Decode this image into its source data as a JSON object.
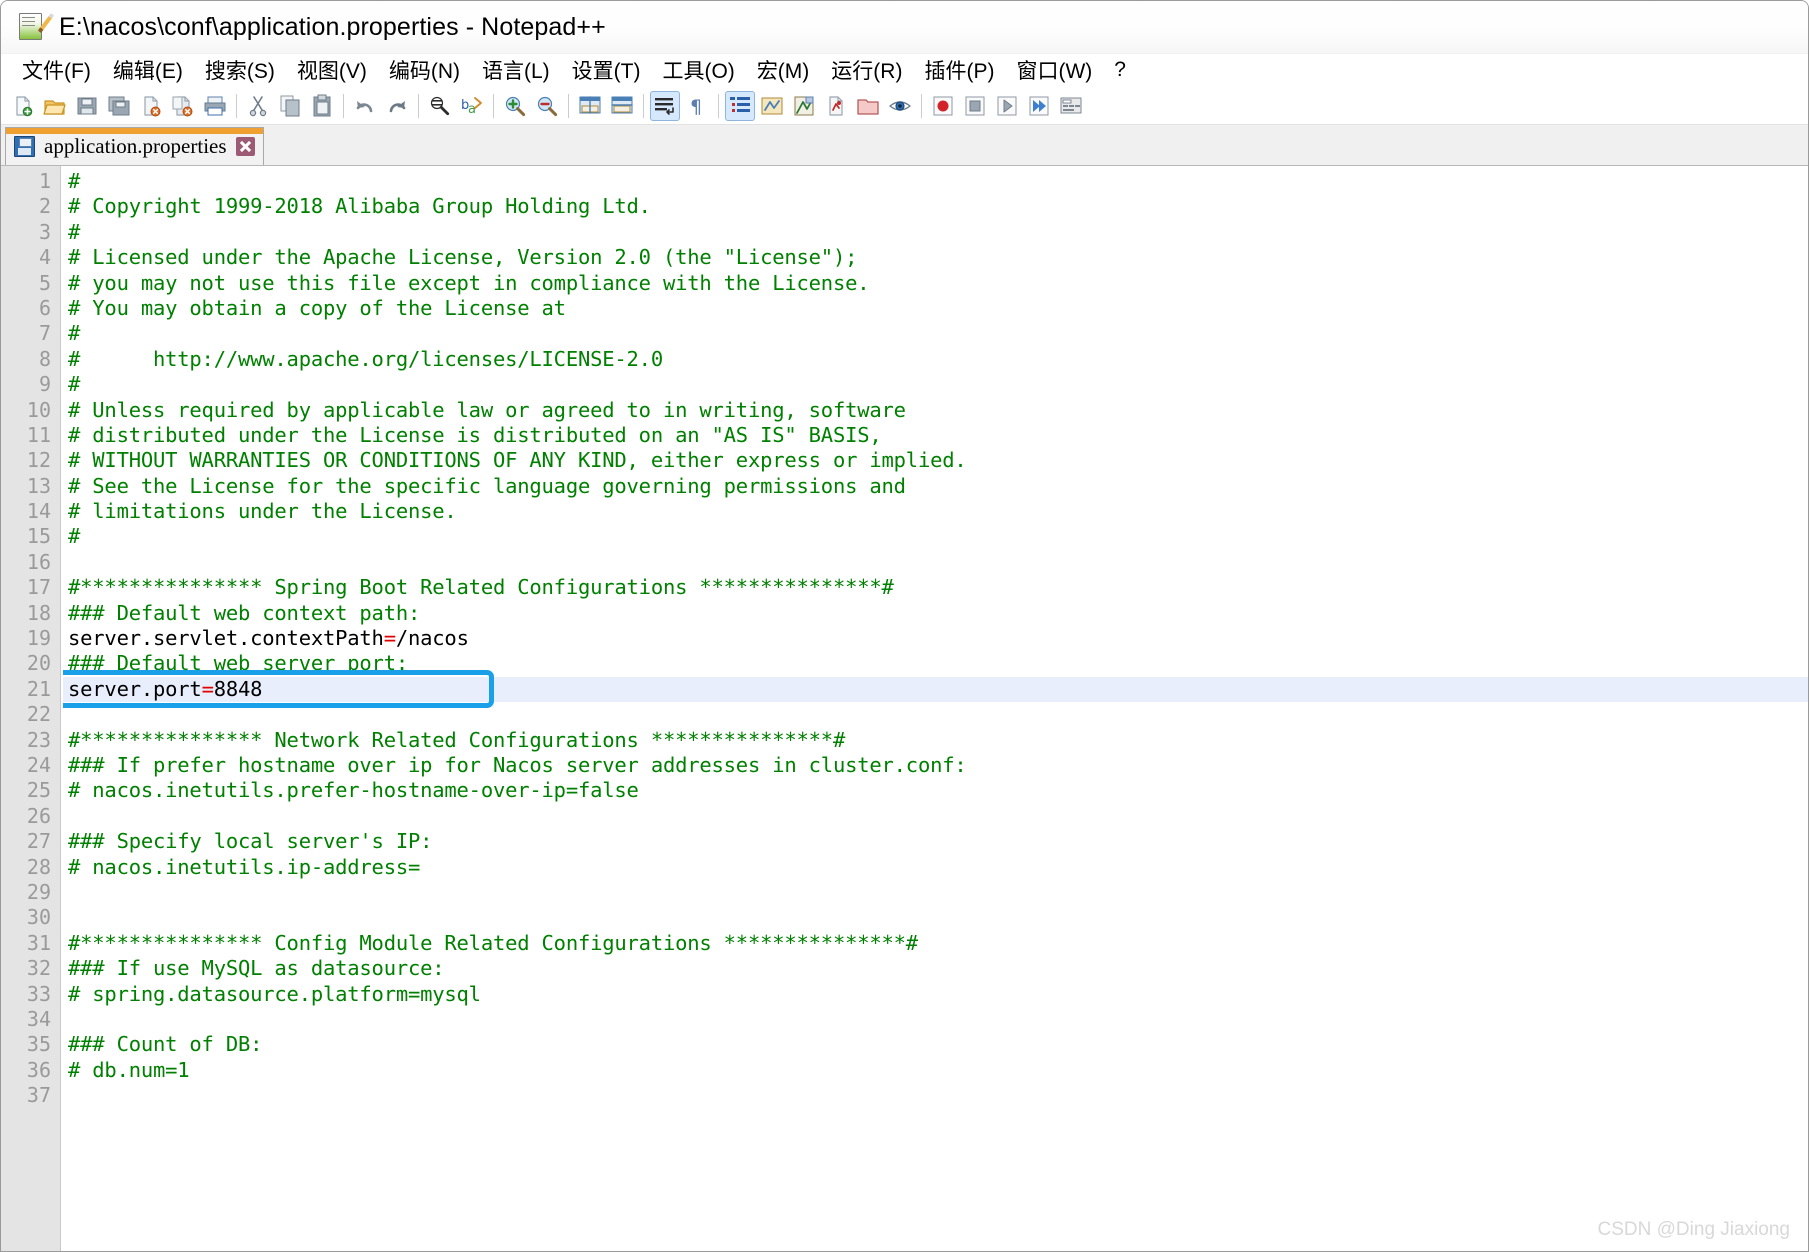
{
  "window": {
    "title": "E:\\nacos\\conf\\application.properties - Notepad++",
    "icon": "notepad-plus-plus-icon"
  },
  "menubar": {
    "items": [
      {
        "label": "文件(F)",
        "name": "menu-file"
      },
      {
        "label": "编辑(E)",
        "name": "menu-edit"
      },
      {
        "label": "搜索(S)",
        "name": "menu-search"
      },
      {
        "label": "视图(V)",
        "name": "menu-view"
      },
      {
        "label": "编码(N)",
        "name": "menu-encoding"
      },
      {
        "label": "语言(L)",
        "name": "menu-language"
      },
      {
        "label": "设置(T)",
        "name": "menu-settings"
      },
      {
        "label": "工具(O)",
        "name": "menu-tools"
      },
      {
        "label": "宏(M)",
        "name": "menu-macro"
      },
      {
        "label": "运行(R)",
        "name": "menu-run"
      },
      {
        "label": "插件(P)",
        "name": "menu-plugins"
      },
      {
        "label": "窗口(W)",
        "name": "menu-window"
      },
      {
        "label": "?",
        "name": "menu-help"
      }
    ]
  },
  "toolbar": {
    "buttons": [
      "new-file-icon",
      "open-file-icon",
      "save-icon",
      "save-all-icon",
      "close-file-icon",
      "close-all-icon",
      "print-icon",
      "sep",
      "cut-icon",
      "copy-icon",
      "paste-icon",
      "sep",
      "undo-icon",
      "redo-icon",
      "sep",
      "find-icon",
      "replace-icon",
      "sep",
      "zoom-in-icon",
      "zoom-out-icon",
      "sep",
      "sync-vertical-scroll-icon",
      "sync-horizontal-scroll-icon",
      "sep",
      "word-wrap-icon",
      "show-all-characters-icon",
      "sep",
      "indent-guide-icon",
      "ui-goto-icon",
      "show-function-list-icon",
      "document-map-icon",
      "folder-as-workspace-icon",
      "monitoring-icon",
      "sep",
      "record-macro-icon",
      "stop-recording-icon",
      "play-macro-icon",
      "run-macro-multiple-icon",
      "save-macro-icon"
    ]
  },
  "tab": {
    "label": "application.properties",
    "icon": "saved-document-icon",
    "close_label": "close-tab"
  },
  "editor": {
    "current_line": 21,
    "highlight": {
      "line": 21,
      "color": "#1aa0e8"
    },
    "colors": {
      "comment": "#008000",
      "key": "#000000",
      "operator": "#e00000",
      "line_number": "#9a9a9a",
      "gutter_bg": "#e4e4e4",
      "current_line_bg": "#e8eefb"
    },
    "lines": [
      {
        "n": 1,
        "tokens": [
          {
            "t": "cmt",
            "s": "#"
          }
        ]
      },
      {
        "n": 2,
        "tokens": [
          {
            "t": "cmt",
            "s": "# Copyright 1999-2018 Alibaba Group Holding Ltd."
          }
        ]
      },
      {
        "n": 3,
        "tokens": [
          {
            "t": "cmt",
            "s": "#"
          }
        ]
      },
      {
        "n": 4,
        "tokens": [
          {
            "t": "cmt",
            "s": "# Licensed under the Apache License, Version 2.0 (the \"License\");"
          }
        ]
      },
      {
        "n": 5,
        "tokens": [
          {
            "t": "cmt",
            "s": "# you may not use this file except in compliance with the License."
          }
        ]
      },
      {
        "n": 6,
        "tokens": [
          {
            "t": "cmt",
            "s": "# You may obtain a copy of the License at"
          }
        ]
      },
      {
        "n": 7,
        "tokens": [
          {
            "t": "cmt",
            "s": "#"
          }
        ]
      },
      {
        "n": 8,
        "tokens": [
          {
            "t": "cmt",
            "s": "#      http://www.apache.org/licenses/LICENSE-2.0"
          }
        ]
      },
      {
        "n": 9,
        "tokens": [
          {
            "t": "cmt",
            "s": "#"
          }
        ]
      },
      {
        "n": 10,
        "tokens": [
          {
            "t": "cmt",
            "s": "# Unless required by applicable law or agreed to in writing, software"
          }
        ]
      },
      {
        "n": 11,
        "tokens": [
          {
            "t": "cmt",
            "s": "# distributed under the License is distributed on an \"AS IS\" BASIS,"
          }
        ]
      },
      {
        "n": 12,
        "tokens": [
          {
            "t": "cmt",
            "s": "# WITHOUT WARRANTIES OR CONDITIONS OF ANY KIND, either express or implied."
          }
        ]
      },
      {
        "n": 13,
        "tokens": [
          {
            "t": "cmt",
            "s": "# See the License for the specific language governing permissions and"
          }
        ]
      },
      {
        "n": 14,
        "tokens": [
          {
            "t": "cmt",
            "s": "# limitations under the License."
          }
        ]
      },
      {
        "n": 15,
        "tokens": [
          {
            "t": "cmt",
            "s": "#"
          }
        ]
      },
      {
        "n": 16,
        "tokens": []
      },
      {
        "n": 17,
        "tokens": [
          {
            "t": "cmt",
            "s": "#*************** Spring Boot Related Configurations ***************#"
          }
        ]
      },
      {
        "n": 18,
        "tokens": [
          {
            "t": "cmt",
            "s": "### Default web context path:"
          }
        ]
      },
      {
        "n": 19,
        "tokens": [
          {
            "t": "key",
            "s": "server.servlet.contextPath"
          },
          {
            "t": "eq",
            "s": "="
          },
          {
            "t": "val",
            "s": "/nacos"
          }
        ]
      },
      {
        "n": 20,
        "tokens": [
          {
            "t": "cmt",
            "s": "### Default web server port:"
          }
        ]
      },
      {
        "n": 21,
        "tokens": [
          {
            "t": "key",
            "s": "server.port"
          },
          {
            "t": "eq",
            "s": "="
          },
          {
            "t": "val",
            "s": "8848"
          }
        ]
      },
      {
        "n": 22,
        "tokens": []
      },
      {
        "n": 23,
        "tokens": [
          {
            "t": "cmt",
            "s": "#*************** Network Related Configurations ***************#"
          }
        ]
      },
      {
        "n": 24,
        "tokens": [
          {
            "t": "cmt",
            "s": "### If prefer hostname over ip for Nacos server addresses in cluster.conf:"
          }
        ]
      },
      {
        "n": 25,
        "tokens": [
          {
            "t": "cmt",
            "s": "# nacos.inetutils.prefer-hostname-over-ip=false"
          }
        ]
      },
      {
        "n": 26,
        "tokens": []
      },
      {
        "n": 27,
        "tokens": [
          {
            "t": "cmt",
            "s": "### Specify local server's IP:"
          }
        ]
      },
      {
        "n": 28,
        "tokens": [
          {
            "t": "cmt",
            "s": "# nacos.inetutils.ip-address="
          }
        ]
      },
      {
        "n": 29,
        "tokens": []
      },
      {
        "n": 30,
        "tokens": []
      },
      {
        "n": 31,
        "tokens": [
          {
            "t": "cmt",
            "s": "#*************** Config Module Related Configurations ***************#"
          }
        ]
      },
      {
        "n": 32,
        "tokens": [
          {
            "t": "cmt",
            "s": "### If use MySQL as datasource:"
          }
        ]
      },
      {
        "n": 33,
        "tokens": [
          {
            "t": "cmt",
            "s": "# spring.datasource.platform=mysql"
          }
        ]
      },
      {
        "n": 34,
        "tokens": []
      },
      {
        "n": 35,
        "tokens": [
          {
            "t": "cmt",
            "s": "### Count of DB:"
          }
        ]
      },
      {
        "n": 36,
        "tokens": [
          {
            "t": "cmt",
            "s": "# db.num=1"
          }
        ]
      },
      {
        "n": 37,
        "tokens": []
      }
    ]
  },
  "watermark": {
    "text": "CSDN @Ding Jiaxiong"
  }
}
